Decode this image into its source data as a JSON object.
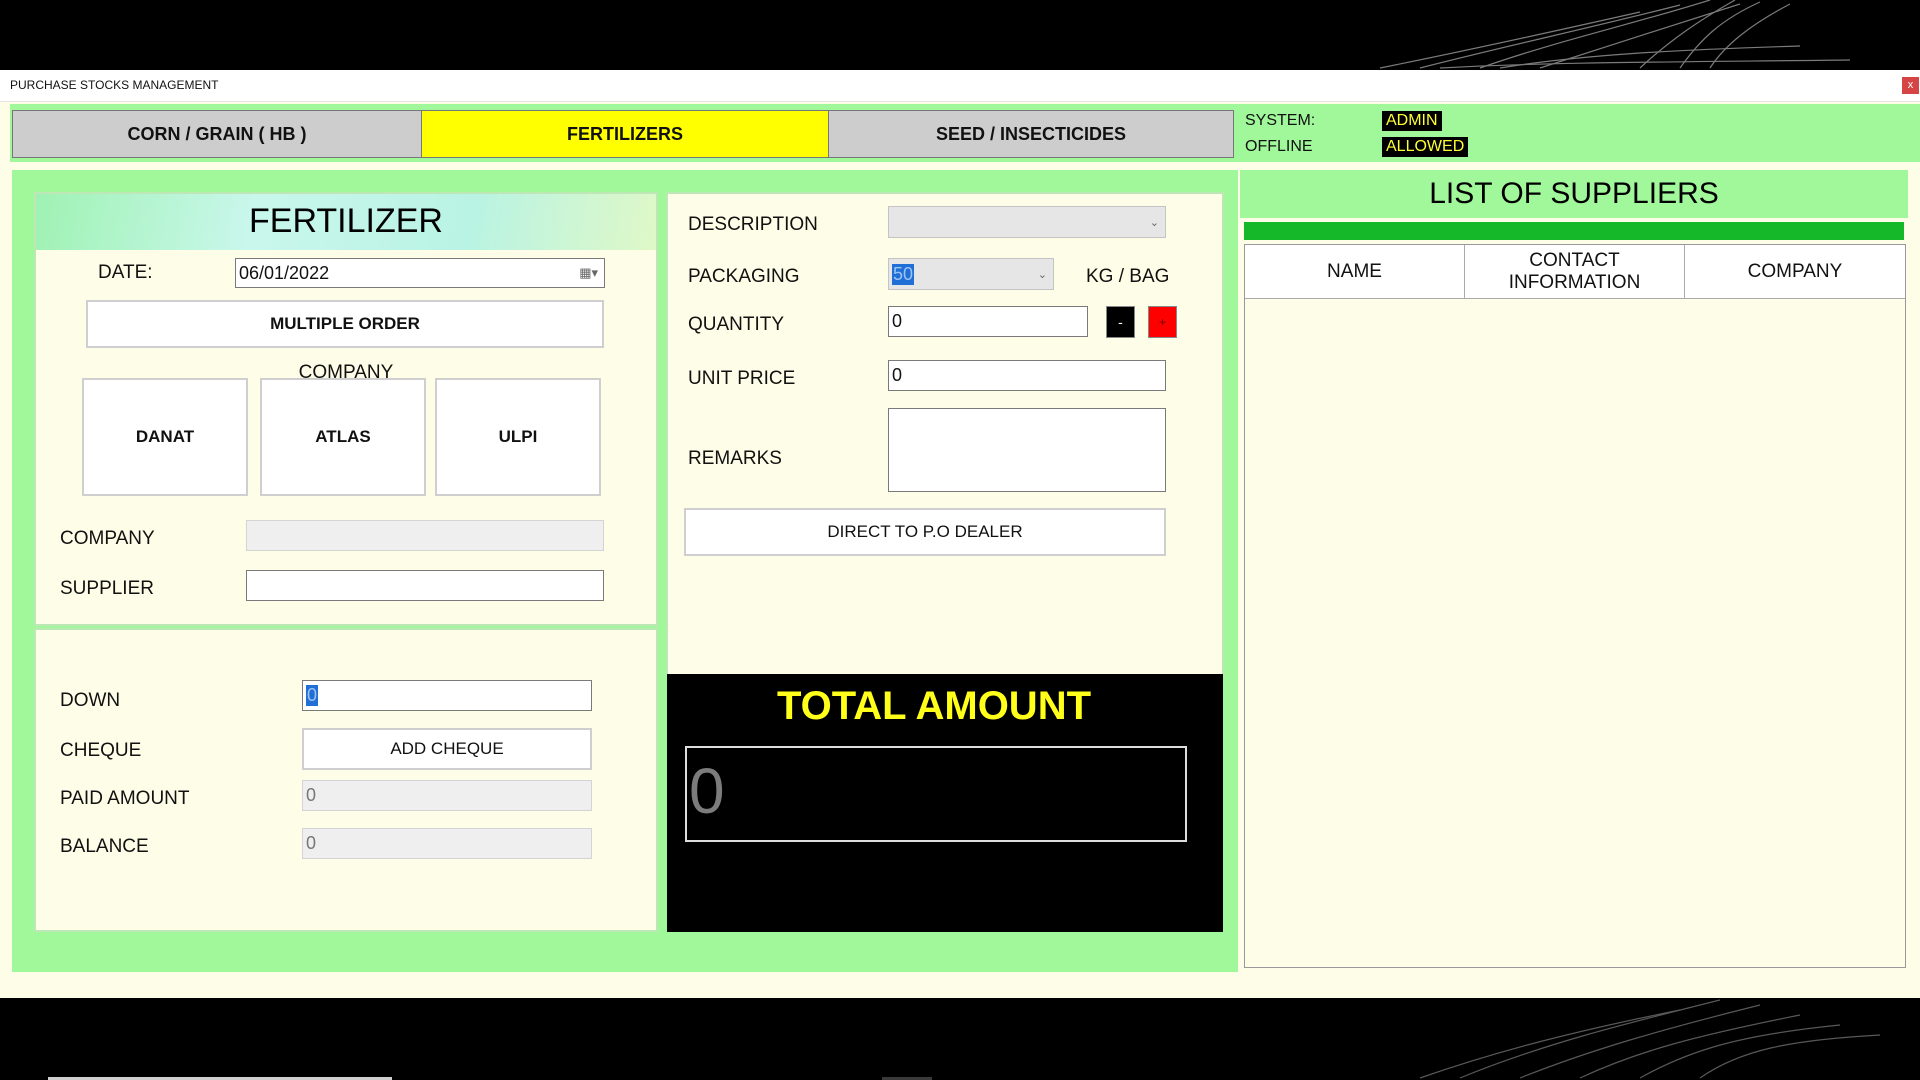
{
  "window": {
    "title": "PURCHASE STOCKS MANAGEMENT",
    "close_icon": "x"
  },
  "tabs": [
    {
      "label": "CORN / GRAIN ( HB )",
      "active": false
    },
    {
      "label": "FERTILIZERS",
      "active": true
    },
    {
      "label": "SEED / INSECTICIDES",
      "active": false
    }
  ],
  "status": {
    "system_label": "SYSTEM:",
    "system_value": "ADMIN",
    "offline_label": "OFFLINE",
    "offline_value": "ALLOWED"
  },
  "form": {
    "title": "FERTILIZER",
    "date_label": "DATE:",
    "date_value": "06/01/2022",
    "multiple_order_label": "MULTIPLE ORDER",
    "company_heading": "COMPANY",
    "company_buttons": [
      "DANAT",
      "ATLAS",
      "ULPI"
    ],
    "company_label": "COMPANY",
    "company_value": "",
    "supplier_label": "SUPPLIER",
    "supplier_value": ""
  },
  "payment": {
    "down_label": "DOWN",
    "down_value": "0",
    "cheque_label": "CHEQUE",
    "add_cheque_label": "ADD CHEQUE",
    "paid_label": "PAID AMOUNT",
    "paid_value": "0",
    "balance_label": "BALANCE",
    "balance_value": "0"
  },
  "item": {
    "description_label": "DESCRIPTION",
    "description_value": "",
    "packaging_label": "PACKAGING",
    "packaging_value": "50",
    "packaging_unit": "KG / BAG",
    "quantity_label": "QUANTITY",
    "quantity_value": "0",
    "minus_label": "-",
    "plus_label": "+",
    "unit_price_label": "UNIT PRICE",
    "unit_price_value": "0",
    "remarks_label": "REMARKS",
    "remarks_value": "",
    "direct_po_label": "DIRECT TO P.O DEALER"
  },
  "total": {
    "title": "TOTAL AMOUNT",
    "value": "0"
  },
  "suppliers": {
    "title": "LIST OF SUPPLIERS",
    "columns": [
      "NAME",
      "CONTACT\nINFORMATION",
      "COMPANY"
    ],
    "rows": []
  },
  "colors": {
    "panel_green": "#a0f89a",
    "active_tab": "#ffff00",
    "total_bg": "#000000",
    "total_text": "#ffff1a",
    "header_bar": "#14b829",
    "plus_button": "#ff0000"
  }
}
